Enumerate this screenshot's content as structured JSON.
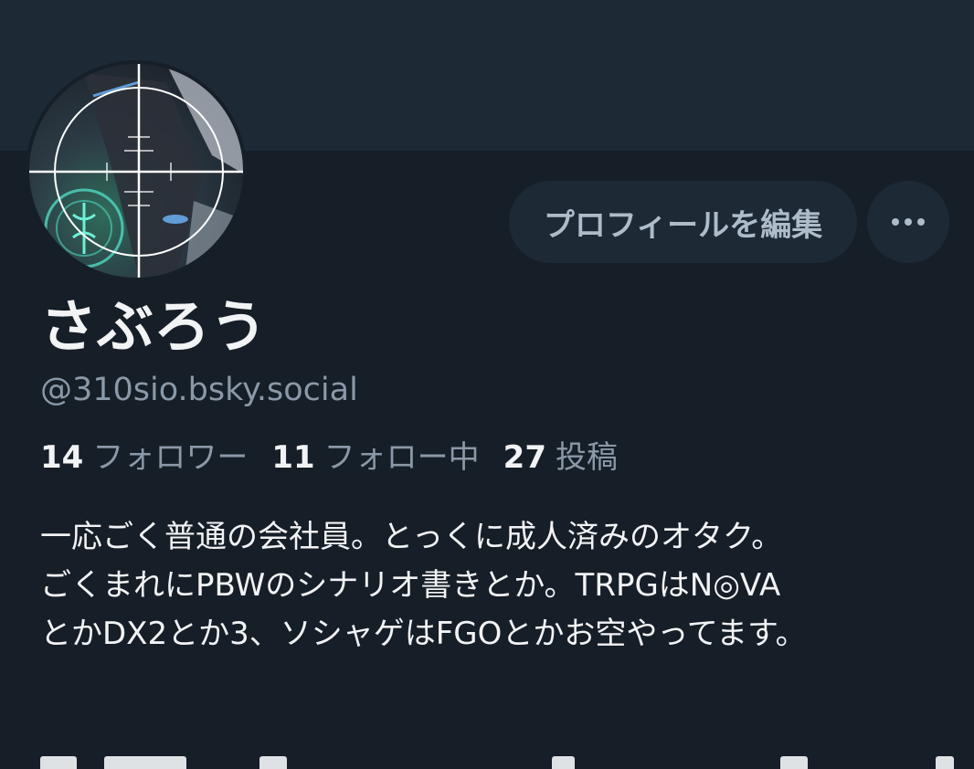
{
  "profile": {
    "display_name": "さぶろう",
    "handle": "@310sio.bsky.social",
    "stats": [
      {
        "count": "14",
        "label": "フォロワー"
      },
      {
        "count": "11",
        "label": "フォロー中"
      },
      {
        "count": "27",
        "label": "投稿"
      }
    ],
    "bio_lines": [
      "一応ごく普通の会社員。とっくに成人済みのオタク。",
      "ごくまれにPBWのシナリオ書きとか。TRPGはN◎VA",
      "とかDX2とか3、ソシャゲはFGOとかお空やってます。"
    ]
  },
  "actions": {
    "edit_profile_label": "プロフィールを編集",
    "more_icon": "ellipsis-icon"
  },
  "colors": {
    "background": "#161e27",
    "banner": "#1e2936",
    "button_bg": "#1e2936",
    "text_primary": "#f1f3f5",
    "text_secondary": "#8a98a7"
  }
}
